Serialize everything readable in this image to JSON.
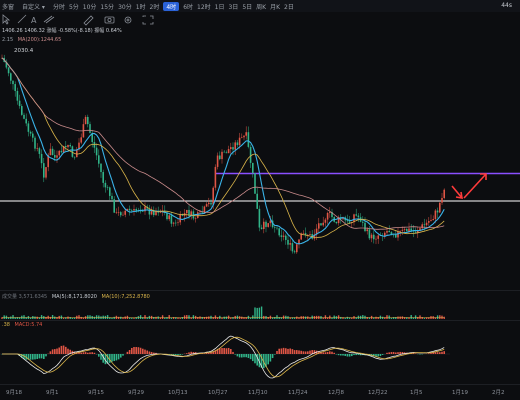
{
  "toolbar": {
    "left_labels": [
      "多窗",
      "自定义 ▾"
    ],
    "intervals": [
      "分时",
      "5分",
      "10分",
      "15分",
      "30分",
      "1时",
      "2时",
      "4时",
      "6时",
      "12时",
      "1日",
      "3日",
      "5日",
      "周K",
      "月K",
      "2日"
    ],
    "active_interval": "4时",
    "right_text": "44s"
  },
  "main_legend": {
    "ohlc": "1406.26  1406.32  涨幅 -0.58%(-8.18)  振幅 0.64%",
    "ma_prefix": "2.15",
    "ma200": "MA(200):1244.65",
    "high_label": "2030.4"
  },
  "volume_legend": {
    "prefix": "成交量 3,571.6345",
    "ma5": "MA(5):8,171.8020",
    "ma10": "MA(10):7,252.8780"
  },
  "macd_legend": {
    "prefix": ".38",
    "macd": "MACD:5.74"
  },
  "x_axis": [
    "9月18",
    "9月1",
    "9月15",
    "9月29",
    "10月13",
    "10月27",
    "11月10",
    "11月24",
    "12月8",
    "12月22",
    "1月5",
    "1月19",
    "2月2"
  ],
  "colors": {
    "up": "#e05545",
    "down": "#31b489",
    "ma_blue": "#3ab3e8",
    "ma_yellow": "#d9b44a",
    "ma_pink": "#c98b8b",
    "purple_line": "#8a4fff",
    "white_line": "#ffffff",
    "arrow": "#ff3b3b",
    "dif": "#e8e8e8",
    "dea": "#d9b44a"
  }
}
